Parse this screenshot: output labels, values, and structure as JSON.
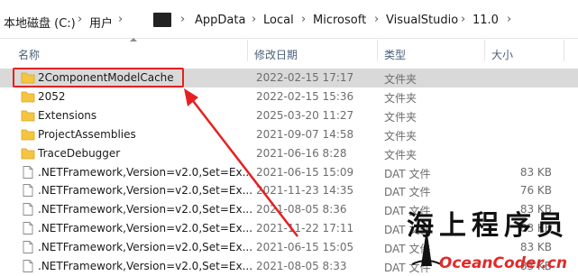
{
  "breadcrumb": {
    "items": [
      "本地磁盘 (C:)",
      "用户",
      "AppData",
      "Local",
      "Microsoft",
      "VisualStudio",
      "11.0"
    ],
    "separator": "›"
  },
  "columns": {
    "name": "名称",
    "date": "修改日期",
    "type": "类型",
    "size": "大小"
  },
  "rows": [
    {
      "name": "2ComponentModelCache",
      "date": "2022-02-15 17:17",
      "type": "文件夹",
      "size": "",
      "icon": "folder-icon"
    },
    {
      "name": "2052",
      "date": "2022-02-15 15:36",
      "type": "文件夹",
      "size": "",
      "icon": "folder-icon"
    },
    {
      "name": "Extensions",
      "date": "2025-03-20 11:27",
      "type": "文件夹",
      "size": "",
      "icon": "folder-icon"
    },
    {
      "name": "ProjectAssemblies",
      "date": "2021-09-07 14:58",
      "type": "文件夹",
      "size": "",
      "icon": "folder-icon"
    },
    {
      "name": "TraceDebugger",
      "date": "2021-06-16 8:28",
      "type": "文件夹",
      "size": "",
      "icon": "folder-icon"
    },
    {
      "name": ".NETFramework,Version=v2.0,Set=Ex...",
      "date": "2021-06-15 15:09",
      "type": "DAT 文件",
      "size": "83 KB",
      "icon": "file-icon"
    },
    {
      "name": ".NETFramework,Version=v2.0,Set=Ex...",
      "date": "2021-11-23 14:35",
      "type": "DAT 文件",
      "size": "76 KB",
      "icon": "file-icon"
    },
    {
      "name": ".NETFramework,Version=v2.0,Set=Ex...",
      "date": "2021-08-05 8:36",
      "type": "DAT 文件",
      "size": "83 KB",
      "icon": "file-icon"
    },
    {
      "name": ".NETFramework,Version=v2.0,Set=Ex...",
      "date": "2021-11-22 17:11",
      "type": "DAT 文件",
      "size": "83 KB",
      "icon": "file-icon"
    },
    {
      "name": ".NETFramework,Version=v2.0,Set=Ex...",
      "date": "2021-06-15 15:05",
      "type": "DAT 文件",
      "size": "83 KB",
      "icon": "file-icon"
    },
    {
      "name": ".NETFramework,Version=v2.0,Set=Ex...",
      "date": "2021-08-05 8:33",
      "type": "DAT 文件",
      "size": "83 KB",
      "icon": "file-icon"
    }
  ],
  "watermark": {
    "title": "海上程序员",
    "subtitle": "OceanCoder.cn"
  },
  "colors": {
    "highlight": "#e62020",
    "folder": "#f5c542",
    "hover_row": "#d9d9d9"
  }
}
